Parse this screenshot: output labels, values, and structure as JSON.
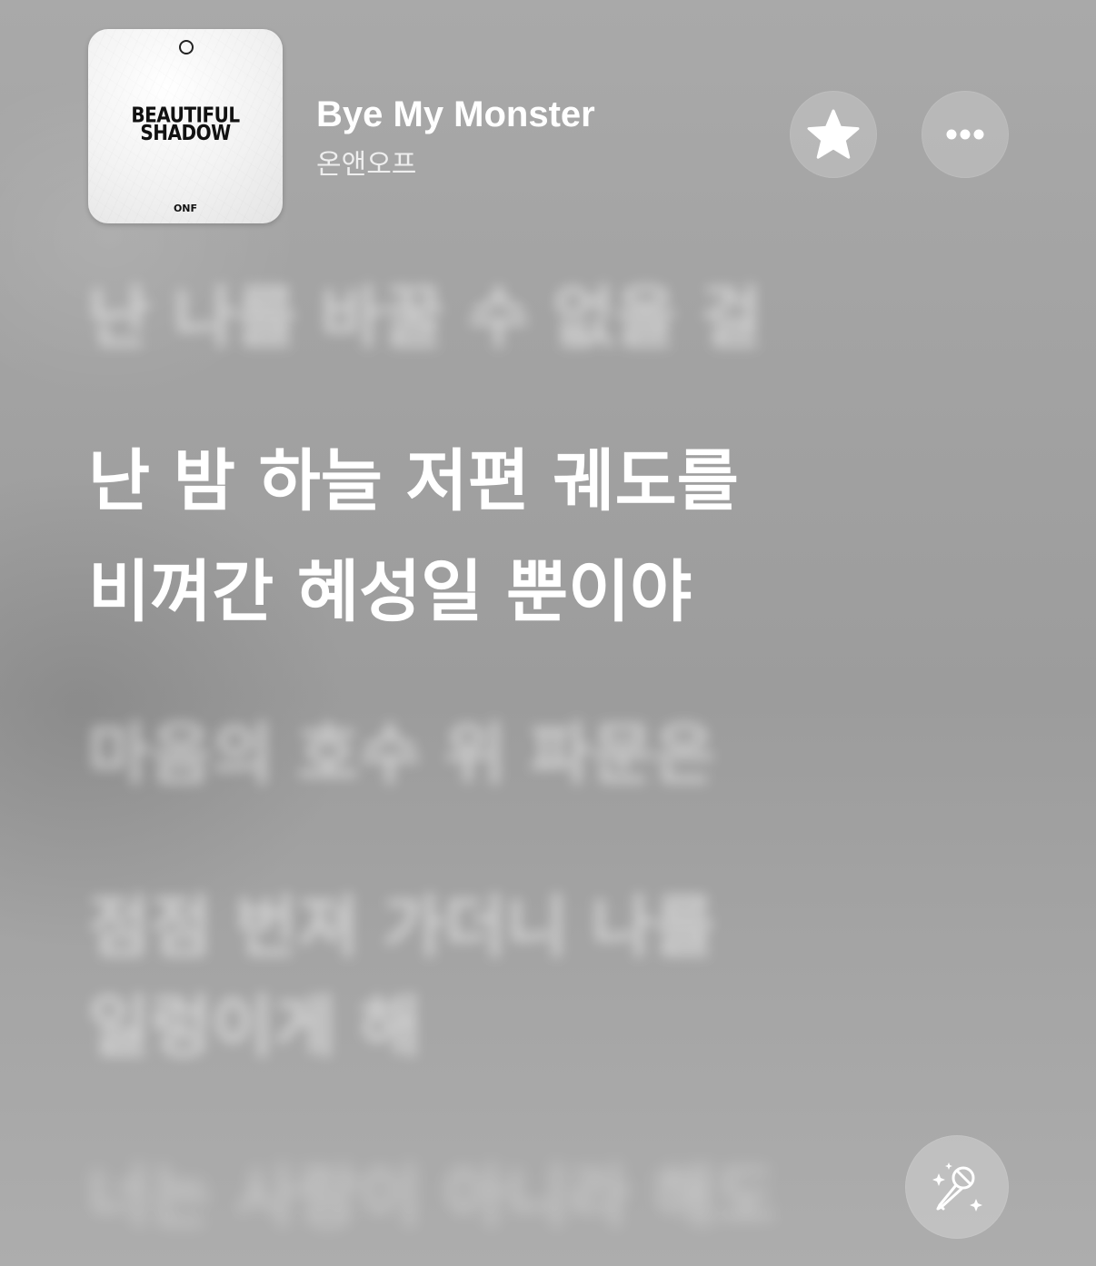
{
  "now_playing": {
    "song_title": "Bye My Monster",
    "artist": "온앤오프",
    "album_art": {
      "title_line1": "BEAUTIFUL",
      "title_line2": "SHADOW",
      "artist_mark": "ONF"
    }
  },
  "actions": {
    "favorite_icon": "star-icon",
    "more_icon": "ellipsis-icon",
    "lyrics_mode_icon": "microphone-sparkle-icon"
  },
  "lyrics": {
    "previous_line": "난 나를 바꿀 수 없을 걸",
    "current_line_1": "난 밤 하늘 저편 궤도를",
    "current_line_2": "비껴간 혜성일 뿐이야",
    "next_line_1": "마음의 호수 위 파문은",
    "next_line_2": "점점 번져 가더니 나를",
    "next_line_3": "일렁이게 해",
    "next_line_4": "너는 사랑이 아니라 해도"
  },
  "colors": {
    "background": "#a3a3a3",
    "text_primary": "#ffffff",
    "button_fill": "rgba(255,255,255,0.20)"
  }
}
